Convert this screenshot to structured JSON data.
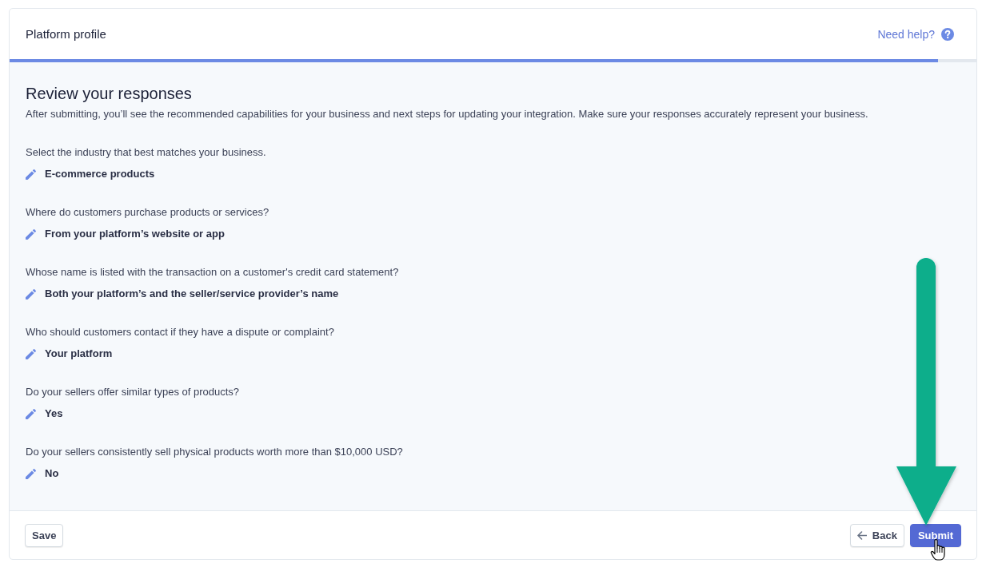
{
  "header": {
    "title": "Platform profile",
    "help_link": "Need help?"
  },
  "progress": {
    "level": 0.96
  },
  "review": {
    "title": "Review your responses",
    "description": "After submitting, you’ll see the recommended capabilities for your business and next steps for updating your integration. Make sure your responses accurately represent your business."
  },
  "responses": [
    {
      "question": "Select the industry that best matches your business.",
      "answer": "E-commerce products"
    },
    {
      "question": "Where do customers purchase products or services?",
      "answer": "From your platform’s website or app"
    },
    {
      "question": "Whose name is listed with the transaction on a customer's credit card statement?",
      "answer": "Both your platform’s and the seller/service provider’s name"
    },
    {
      "question": "Who should customers contact if they have a dispute or complaint?",
      "answer": "Your platform"
    },
    {
      "question": "Do your sellers offer similar types of products?",
      "answer": "Yes"
    },
    {
      "question": "Do your sellers consistently sell physical products worth more than $10,000 USD?",
      "answer": "No"
    }
  ],
  "footer": {
    "save_button": "Save",
    "back_button": "Back",
    "submit_button": "Submit"
  }
}
